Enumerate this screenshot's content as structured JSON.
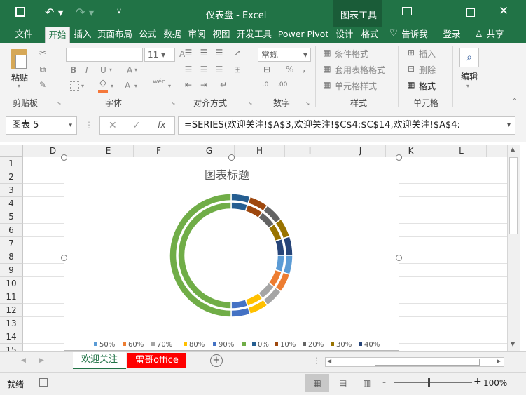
{
  "titlebar": {
    "doc_title": "仪表盘 - Excel",
    "context_tab_group": "图表工具"
  },
  "tabs": [
    "文件",
    "开始",
    "插入",
    "页面布局",
    "公式",
    "数据",
    "审阅",
    "视图",
    "开发工具",
    "Power Pivot",
    "设计",
    "格式"
  ],
  "tell_me": "告诉我",
  "login": "登录",
  "share": "共享",
  "ribbon": {
    "clipboard": {
      "paste": "粘贴",
      "label": "剪贴板"
    },
    "font": {
      "size": "11",
      "bold": "B",
      "italic": "I",
      "underline": "U",
      "fontA": "A",
      "wen": "wén",
      "label": "字体"
    },
    "align": {
      "label": "对齐方式"
    },
    "number": {
      "format": "常规",
      "pct": "%",
      "comma": ",",
      "label": "数字"
    },
    "styles": {
      "cond": "条件格式",
      "table": "套用表格格式",
      "cell": "单元格样式",
      "label": "样式"
    },
    "cells": {
      "insert": "插入",
      "delete": "删除",
      "format": "格式",
      "label": "单元格"
    },
    "edit": {
      "label": "编辑"
    }
  },
  "formula_bar": {
    "name_box": "图表 5",
    "fx": "fx",
    "formula": "=SERIES(欢迎关注!$A$3,欢迎关注!$C$4:$C$14,欢迎关注!$A$4:"
  },
  "columns": [
    "D",
    "E",
    "F",
    "G",
    "H",
    "I",
    "J",
    "K",
    "L"
  ],
  "rows": [
    "1",
    "2",
    "3",
    "4",
    "5",
    "6",
    "7",
    "8",
    "9",
    "10",
    "11",
    "12",
    "13",
    "14",
    "15"
  ],
  "chart": {
    "title": "图表标题",
    "legend": [
      {
        "label": "50%",
        "color": "#5b9bd5"
      },
      {
        "label": "60%",
        "color": "#ed7d31"
      },
      {
        "label": "70%",
        "color": "#a5a5a5"
      },
      {
        "label": "80%",
        "color": "#ffc000"
      },
      {
        "label": "90%",
        "color": "#4472c4"
      },
      {
        "label": "",
        "color": "#70ad47"
      },
      {
        "label": "0%",
        "color": "#255e91"
      },
      {
        "label": "10%",
        "color": "#9e480e"
      },
      {
        "label": "20%",
        "color": "#636363"
      },
      {
        "label": "30%",
        "color": "#997300"
      },
      {
        "label": "40%",
        "color": "#264478"
      }
    ]
  },
  "chart_data": {
    "type": "pie",
    "title": "图表标题",
    "subtype": "doughnut",
    "rings": 2,
    "categories": [
      "0%",
      "10%",
      "20%",
      "30%",
      "40%",
      "50%",
      "60%",
      "70%",
      "80%",
      "90%",
      ""
    ],
    "values": [
      10,
      10,
      10,
      10,
      10,
      10,
      10,
      10,
      10,
      10,
      100
    ],
    "colors": [
      "#255e91",
      "#9e480e",
      "#636363",
      "#997300",
      "#264478",
      "#5b9bd5",
      "#ed7d31",
      "#a5a5a5",
      "#ffc000",
      "#4472c4",
      "#70ad47"
    ],
    "legend_position": "bottom"
  },
  "sheets": [
    "欢迎关注",
    "雷哥office"
  ],
  "status": {
    "ready": "就绪",
    "zoom": "100%",
    "minus": "-",
    "plus": "+"
  }
}
